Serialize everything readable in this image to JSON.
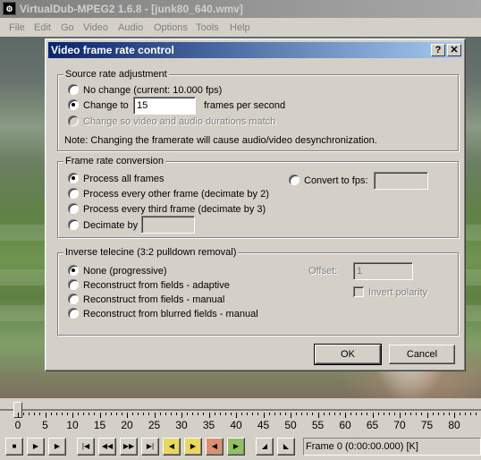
{
  "main": {
    "title": "VirtualDub-MPEG2 1.6.8 - [junk80_640.wmv]",
    "menu": [
      "File",
      "Edit",
      "Go",
      "Video",
      "Audio",
      "Options",
      "Tools",
      "Help"
    ]
  },
  "dialog": {
    "title": "Video frame rate control",
    "help_label": "?",
    "close_label": "✕",
    "source": {
      "legend": "Source rate adjustment",
      "no_change": "No change (current: 10.000 fps)",
      "change_to": "Change to",
      "change_value": "15",
      "fps_unit": "frames per second",
      "match": "Change so video and audio durations match",
      "note": "Note: Changing the framerate will cause audio/video desynchronization."
    },
    "conversion": {
      "legend": "Frame rate conversion",
      "all": "Process all frames",
      "other": "Process every other frame (decimate by 2)",
      "third": "Process every third frame (decimate by 3)",
      "decimate": "Decimate by",
      "decimate_value": "",
      "convert": "Convert to fps:",
      "convert_value": ""
    },
    "telecine": {
      "legend": "Inverse telecine (3:2 pulldown removal)",
      "none": "None (progressive)",
      "adaptive": "Reconstruct from fields - adaptive",
      "manual": "Reconstruct from fields - manual",
      "blurred": "Reconstruct from blurred fields - manual",
      "offset_label": "Offset:",
      "offset_value": "1",
      "invert": "Invert polarity"
    },
    "ok_label": "OK",
    "cancel_label": "Cancel"
  },
  "timeline": {
    "ticks": [
      "0",
      "5",
      "10",
      "15",
      "20",
      "25",
      "30",
      "35",
      "40",
      "45",
      "50",
      "55",
      "60",
      "65",
      "70",
      "75",
      "80"
    ],
    "position_frame": 0
  },
  "toolbar": {
    "buttons": [
      "stop-icon",
      "play-input-icon",
      "play-output-icon",
      "start-icon",
      "prev-frame-icon",
      "next-frame-icon",
      "end-icon",
      "prev-key-icon",
      "next-key-icon",
      "scene-back-icon",
      "scene-fwd-icon",
      "mark-in-icon",
      "mark-out-icon"
    ],
    "frame_status": "Frame 0 (0:00:00.000) [K]"
  }
}
